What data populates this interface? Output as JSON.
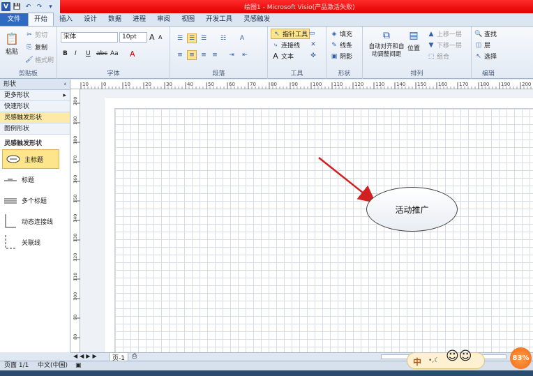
{
  "qat": {
    "logo": "V",
    "save": "💾",
    "undo": "↶",
    "redo": "↷",
    "more": "▾"
  },
  "window": {
    "title": "绘图1 - Microsoft Visio(产品激活失败)"
  },
  "tabs": [
    "文件",
    "开始",
    "插入",
    "设计",
    "数据",
    "进程",
    "审阅",
    "视图",
    "开发工具",
    "灵感触发"
  ],
  "ribbon": {
    "clipboard": {
      "paste": "粘贴",
      "cut": "剪切",
      "copy": "复制",
      "format_painter": "格式刷",
      "label": "剪贴板"
    },
    "font": {
      "name": "宋体",
      "size": "10pt",
      "grow": "A",
      "shrink": "A",
      "bold": "B",
      "italic": "I",
      "underline": "U",
      "strike": "abc",
      "case": "Aa",
      "color": "A",
      "label": "字体"
    },
    "paragraph": {
      "label": "段落"
    },
    "tools": {
      "pointer": "指针工具",
      "connector": "连接线",
      "text": "文本",
      "label": "工具"
    },
    "shape": {
      "fill": "填充",
      "line": "线条",
      "shadow": "阴影",
      "label": "形状"
    },
    "arrange": {
      "auto_align": "自动对齐和自动调整间距",
      "position": "位置",
      "bring_forward": "上移一层",
      "send_backward": "下移一层",
      "group": "组合",
      "label": "排列"
    },
    "editing": {
      "find": "查找",
      "layers": "层",
      "select": "选择",
      "label": "编辑"
    }
  },
  "shapes_panel": {
    "header": "形状",
    "rows": [
      "更多形状",
      "快速形状",
      "灵感触发形状",
      "图例形状"
    ],
    "active_row": "灵感触发形状",
    "stencil_title": "灵感触发形状",
    "items": [
      "主标题",
      "标题",
      "多个标题",
      "动态连接线",
      "关联线"
    ]
  },
  "ruler": {
    "h": [
      "10",
      "0",
      "10",
      "20",
      "30",
      "40",
      "50",
      "60",
      "70",
      "80",
      "90",
      "100",
      "110",
      "120",
      "130",
      "140",
      "150",
      "160",
      "170",
      "180",
      "190",
      "200"
    ],
    "v": [
      "200",
      "190",
      "180",
      "170",
      "160",
      "150",
      "140",
      "130",
      "120",
      "110",
      "100",
      "90",
      "80"
    ]
  },
  "canvas": {
    "bubble_text": "活动推广"
  },
  "pagebar": {
    "page_tab": "页-1"
  },
  "status": {
    "page": "页面 1/1",
    "lang": "中文(中国)"
  },
  "ime": {
    "mode": "中"
  },
  "zoom_badge": "83%"
}
